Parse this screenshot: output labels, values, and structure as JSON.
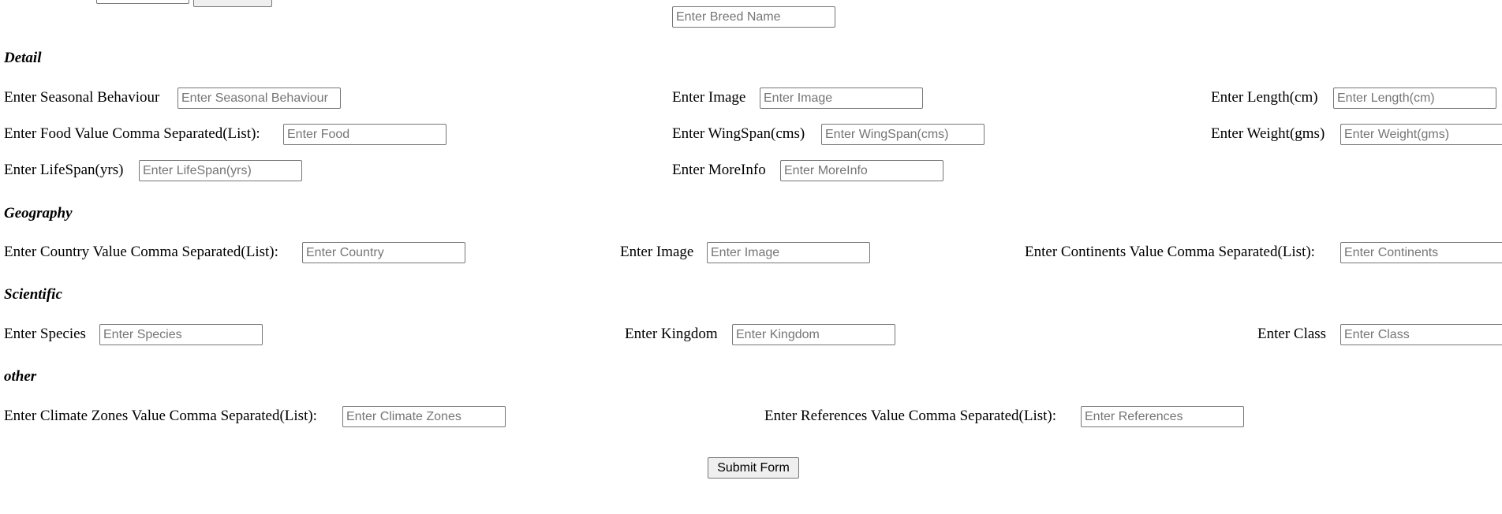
{
  "top": {
    "breed_name_placeholder": "Enter Breed Name"
  },
  "detail": {
    "heading": "Detail",
    "seasonal_label": "Enter Seasonal Behaviour",
    "seasonal_placeholder": "Enter Seasonal Behaviour",
    "image_label": "Enter Image",
    "image_placeholder": "Enter Image",
    "length_label": "Enter Length(cm)",
    "length_placeholder": "Enter Length(cm)",
    "food_label": "Enter Food Value Comma Separated(List):",
    "food_placeholder": "Enter Food",
    "wingspan_label": "Enter WingSpan(cms)",
    "wingspan_placeholder": "Enter WingSpan(cms)",
    "weight_label": "Enter Weight(gms)",
    "weight_placeholder": "Enter Weight(gms)",
    "lifespan_label": "Enter LifeSpan(yrs)",
    "lifespan_placeholder": "Enter LifeSpan(yrs)",
    "moreinfo_label": "Enter MoreInfo",
    "moreinfo_placeholder": "Enter MoreInfo"
  },
  "geography": {
    "heading": "Geography",
    "country_label": "Enter Country Value Comma Separated(List):",
    "country_placeholder": "Enter Country",
    "image_label": "Enter Image",
    "image_placeholder": "Enter Image",
    "continents_label": "Enter Continents Value Comma Separated(List):",
    "continents_placeholder": "Enter Continents"
  },
  "scientific": {
    "heading": "Scientific",
    "species_label": "Enter Species",
    "species_placeholder": "Enter Species",
    "kingdom_label": "Enter Kingdom",
    "kingdom_placeholder": "Enter Kingdom",
    "class_label": "Enter Class",
    "class_placeholder": "Enter Class"
  },
  "other": {
    "heading": "other",
    "climate_label": "Enter Climate Zones Value Comma Separated(List):",
    "climate_placeholder": "Enter Climate Zones",
    "references_label": "Enter References Value Comma Separated(List):",
    "references_placeholder": "Enter References"
  },
  "submit_label": "Submit Form"
}
